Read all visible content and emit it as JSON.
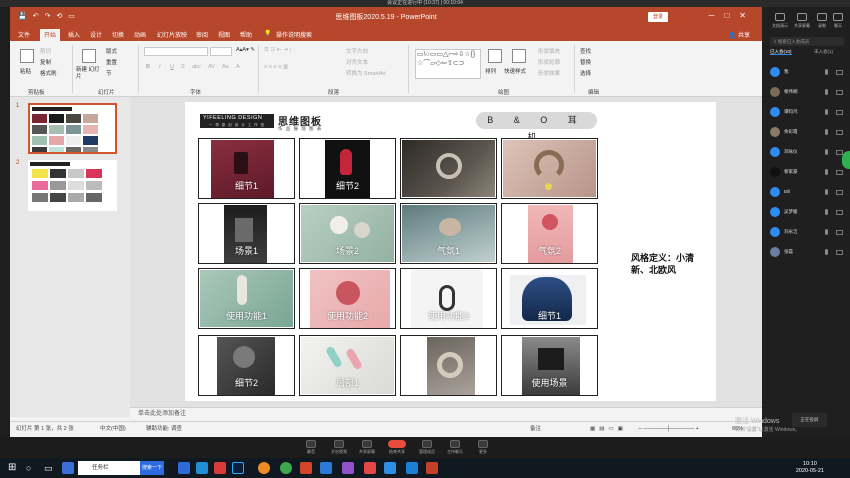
{
  "meeting_bar": {
    "title": "会议正在进行中 (10:37) | 00:10:04"
  },
  "powerpoint": {
    "window_title": "思维图板2020.5.19  -  PowerPoint",
    "login_label": "登录",
    "share_label": "共享",
    "tabs": [
      "文件",
      "开始",
      "插入",
      "设计",
      "切换",
      "动画",
      "幻灯片放映",
      "审阅",
      "视图",
      "帮助",
      "操作说明搜索"
    ],
    "ribbon": {
      "clipboard": {
        "paste": "粘贴",
        "cut": "剪切",
        "copy": "复制",
        "format_painter": "格式刷",
        "label": "剪贴板"
      },
      "slides": {
        "new_slide": "新建\n幻灯片",
        "layout": "版式",
        "reset": "重置",
        "section": "节",
        "label": "幻灯片"
      },
      "font": {
        "label": "字体",
        "bold": "B",
        "italic": "I",
        "underline": "U",
        "strike": "S",
        "shadow": "abc",
        "spacing": "AV",
        "case": "Aa",
        "color": "A"
      },
      "paragraph": {
        "label": "段落",
        "text_direction": "文字方向",
        "align_text": "对齐文本",
        "smartart": "转换为 SmartArt"
      },
      "drawing": {
        "label": "绘图",
        "arrange": "排列",
        "quick_styles": "快速样式",
        "fill": "形状填充",
        "outline": "形状轮廓",
        "effects": "形状效果",
        "shapes_glyphs": "▭\\○▭▭△⌐⇨⇩☆{}☆⌒▱◇⇦⇧⊂⊃"
      },
      "editing": {
        "label": "编辑",
        "find": "查找",
        "replace": "替换",
        "select": "选择"
      }
    },
    "thumbnails": [
      {
        "num": "1"
      },
      {
        "num": "2"
      }
    ],
    "slide": {
      "logo_text": "YIFEELING DESIGN",
      "logo_sub": "一 再 原 创 设 计 工 作 室",
      "title": "思维图板",
      "subtitle": "作 品 展 现 图 表",
      "brand": "B & O 耳 机",
      "style_definition": "风格定义：小清新、北欧风",
      "cells": [
        {
          "label": "细节1"
        },
        {
          "label": "细节2"
        },
        {
          "label": ""
        },
        {
          "label": ""
        },
        {
          "label": "场景1"
        },
        {
          "label": "场景2"
        },
        {
          "label": "气氛1"
        },
        {
          "label": "气氛2"
        },
        {
          "label": "使用功能1"
        },
        {
          "label": "使用功能2"
        },
        {
          "label": "使用功能3"
        },
        {
          "label": "细节1"
        },
        {
          "label": "细节2"
        },
        {
          "label": "局部1"
        },
        {
          "label": ""
        },
        {
          "label": "使用场景"
        }
      ]
    },
    "notes_placeholder": "单击此处添加备注",
    "status": {
      "slide_info": "幻灯片 第 1 张，共 2 张",
      "language": "中文(中国)",
      "accessibility": "辅助功能: 调查",
      "notes": "备注",
      "zoom": "86%"
    }
  },
  "right_panel": {
    "top_buttons": [
      "文档演示",
      "共享屏幕",
      "录制",
      "聊天"
    ],
    "search_placeholder": "搜索已入会成员",
    "tabs": [
      "已入会(10)",
      "未入会(1)"
    ],
    "members": [
      {
        "name": "我",
        "color": "#2d8cf0"
      },
      {
        "name": "黎伟桐",
        "color": "#7a6a58"
      },
      {
        "name": "谭钧鸿",
        "color": "#2d8cf0"
      },
      {
        "name": "余彩霞",
        "color": "#8a7a66"
      },
      {
        "name": "邓咏仪",
        "color": "#2d8cf0"
      },
      {
        "name": "黎家豪",
        "color": "#111111"
      },
      {
        "name": "Bill",
        "color": "#2d8cf0"
      },
      {
        "name": "吴梦媛",
        "color": "#2d8cf0"
      },
      {
        "name": "刘永洁",
        "color": "#2d8cf0"
      },
      {
        "name": "张磊",
        "color": "#6a7ea2"
      }
    ],
    "tip_label": "正在投屏"
  },
  "meeting_toolbar": [
    {
      "label": "静音"
    },
    {
      "label": "开启视频"
    },
    {
      "label": "共享屏幕"
    },
    {
      "label": "结束共享"
    },
    {
      "label": "管理成员"
    },
    {
      "label": "主持聊天"
    },
    {
      "label": "更多"
    }
  ],
  "activation": {
    "title": "激活 Windows",
    "subtitle": "转到\"设置\"以激活 Windows。"
  },
  "taskbar": {
    "search_text": "任务栏",
    "search_button": "搜索一下",
    "time": "10:10",
    "date": "2020-05-21"
  }
}
